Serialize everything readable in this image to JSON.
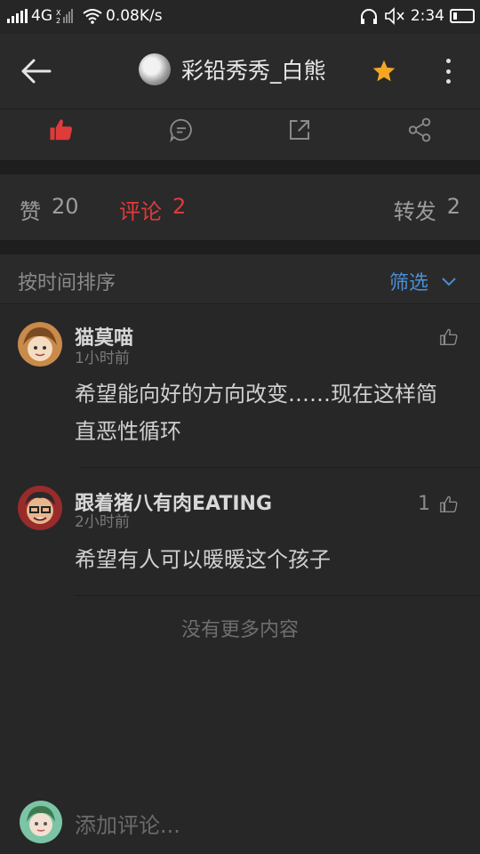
{
  "status_bar": {
    "network": "4G",
    "speed": "0.08K/s",
    "time": "2:34"
  },
  "header": {
    "title": "彩铅秀秀_白熊",
    "back_icon": "arrow-left-icon",
    "star_icon": "star-icon",
    "more_icon": "more-vertical-icon",
    "star_color": "#f5a623"
  },
  "actions": {
    "like_icon": "thumbs-up-icon",
    "comment_icon": "comment-icon",
    "share_icon": "external-share-icon",
    "social_share_icon": "share-nodes-icon",
    "active_color": "#e03a3a"
  },
  "counts": {
    "like_label": "赞",
    "like_count": "20",
    "comment_label": "评论",
    "comment_count": "2",
    "repost_label": "转发",
    "repost_count": "2"
  },
  "sort": {
    "label": "按时间排序",
    "filter_label": "筛选"
  },
  "comments": [
    {
      "name": "猫莫喵",
      "time": "1小时前",
      "text": "希望能向好的方向改变……现在这样简直恶性循环",
      "likes": ""
    },
    {
      "name": "跟着猪八有肉EATING",
      "time": "2小时前",
      "text": "希望有人可以暖暖这个孩子",
      "likes": "1"
    }
  ],
  "no_more": "没有更多内容",
  "input": {
    "placeholder": "添加评论..."
  }
}
